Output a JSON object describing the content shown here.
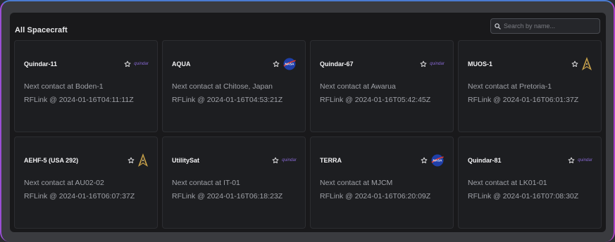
{
  "header": {
    "title": "All Spacecraft"
  },
  "search": {
    "placeholder": "Search by name..."
  },
  "logos": {
    "quindar": "quindar",
    "nasa": "NASA"
  },
  "cards": [
    {
      "name": "Quindar-11",
      "contact": "Next contact at Boden-1",
      "rflink": "RFLink @ 2024-01-16T04:11:11Z",
      "logo": "quindar-logo"
    },
    {
      "name": "AQUA",
      "contact": "Next contact at Chitose, Japan",
      "rflink": "RFLink @ 2024-01-16T04:53:21Z",
      "logo": "nasa-logo"
    },
    {
      "name": "Quindar-67",
      "contact": "Next contact at Awarua",
      "rflink": "RFLink @ 2024-01-16T05:42:45Z",
      "logo": "quindar-logo"
    },
    {
      "name": "MUOS-1",
      "contact": "Next contact at Pretoria-1",
      "rflink": "RFLink @ 2024-01-16T06:01:37Z",
      "logo": "space-force-logo"
    },
    {
      "name": "AEHF-5 (USA 292)",
      "contact": "Next contact at AU02-02",
      "rflink": "RFLink @ 2024-01-16T06:07:37Z",
      "logo": "space-force-logo"
    },
    {
      "name": "UtilitySat",
      "contact": "Next contact at IT-01",
      "rflink": "RFLink @ 2024-01-16T06:18:23Z",
      "logo": "quindar-logo"
    },
    {
      "name": "TERRA",
      "contact": "Next contact at MJCM",
      "rflink": "RFLink @ 2024-01-16T06:20:09Z",
      "logo": "nasa-logo"
    },
    {
      "name": "Quindar-81",
      "contact": "Next contact at LK01-01",
      "rflink": "RFLink @ 2024-01-16T07:08:30Z",
      "logo": "quindar-logo"
    }
  ],
  "colors": {
    "panel_bg": "#19191b",
    "card_bg": "#1d1e21",
    "quindar_purple": "#8a6ad8",
    "nasa_blue": "#1f3fa8",
    "nasa_red": "#e03a2f",
    "space_force_gold": "#c8a24a"
  }
}
